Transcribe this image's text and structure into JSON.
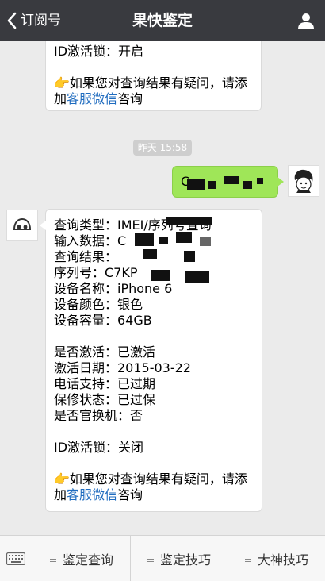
{
  "header": {
    "back_label": "订阅号",
    "title": "果快鉴定",
    "background": "#393a3f"
  },
  "top_message": {
    "id_lock": "ID激活锁：开启",
    "hint_pre": "如果您对查询结果有疑问，请添",
    "hint_link_pre": "加",
    "hint_link": "客服微信",
    "hint_post": "咨询",
    "hint_emoji": "👉"
  },
  "time_badge": "昨天 15:58",
  "user_message": {
    "text_visible": "C",
    "bubble_color": "#9fe658"
  },
  "result": {
    "query_type": "查询类型：IMEI/序列号查询",
    "input_data": "输入数据：C",
    "query_result": "查询结果：",
    "serial": "序列号：C7KP",
    "device_name": "设备名称：iPhone 6",
    "device_color": "设备颜色：银色",
    "capacity": "设备容量：64GB",
    "activated": "是否激活：已激活",
    "activation_date": "激活日期：2015-03-22",
    "phone_support": "电话支持：已过期",
    "warranty": "保修状态：已过保",
    "replaced": "是否官换机：否",
    "id_lock": "ID激活锁：关闭",
    "hint_emoji": "👉",
    "hint_pre": "如果您对查询结果有疑问，请添",
    "hint_link_pre": "加",
    "hint_link": "客服微信",
    "hint_post": "咨询"
  },
  "bottom_menu": {
    "items": [
      "鉴定查询",
      "鉴定技巧",
      "大神技巧"
    ]
  },
  "colors": {
    "link": "#1e6bbf",
    "chat_background": "#ebebeb"
  }
}
